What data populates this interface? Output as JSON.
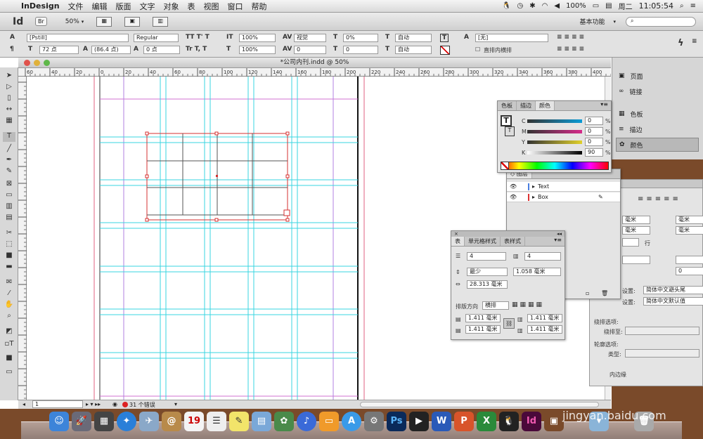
{
  "menubar": {
    "app_name": "InDesign",
    "items": [
      "文件",
      "编辑",
      "版面",
      "文字",
      "对象",
      "表",
      "视图",
      "窗口",
      "帮助"
    ],
    "battery": "100%",
    "day": "周二",
    "time": "11:05:54"
  },
  "appbar": {
    "logo": "Id",
    "bridge": "Br",
    "zoom": "50%",
    "workspace": "基本功能",
    "search_placeholder": ""
  },
  "control": {
    "font_family": "[Pstill]",
    "font_style": "Regular",
    "font_size": "72 点",
    "leading": "(86.4 点)",
    "scale_v": "100%",
    "scale_h": "100%",
    "kerning": "视觉",
    "tracking": "0",
    "baseline": "0 点",
    "tsume": "0%",
    "auto1": "自动",
    "auto2": "自动",
    "char_style": "[无]",
    "direct_horizontal": "直排内横排",
    "skew": "0",
    "tracking2": "0"
  },
  "document": {
    "title": "*公司内刊.indd @ 50%",
    "ruler_labels_h": [
      "60",
      "40",
      "20",
      "0",
      "20",
      "40",
      "60",
      "80",
      "100",
      "120",
      "140",
      "160",
      "180",
      "200",
      "220",
      "240",
      "260",
      "280",
      "300",
      "320",
      "340",
      "360",
      "380",
      "400"
    ],
    "page_number": "1",
    "errors": "31 个错误"
  },
  "sidebar": {
    "items": [
      {
        "label": "页面",
        "icon": "pages-icon"
      },
      {
        "label": "链接",
        "icon": "links-icon"
      },
      {
        "label": "色板",
        "icon": "swatches-icon"
      },
      {
        "label": "描边",
        "icon": "stroke-icon"
      },
      {
        "label": "颜色",
        "icon": "color-icon"
      }
    ]
  },
  "color_panel": {
    "tabs": [
      "色板",
      "描边",
      "颜色"
    ],
    "c_label": "C",
    "m_label": "M",
    "y_label": "Y",
    "k_label": "K",
    "c": "0",
    "m": "0",
    "y": "0",
    "k": "90",
    "pct": "%"
  },
  "layers_panel": {
    "title": "图层",
    "layers": [
      "Text",
      "Box"
    ]
  },
  "table_panel": {
    "tabs": [
      "表",
      "单元格样式",
      "表样式"
    ],
    "rows": "4",
    "cols": "4",
    "row_height_mode": "最少",
    "row_height": "1.058 毫米",
    "col_width": "28.313 毫米",
    "direction_label": "排版方向",
    "direction": "横排",
    "inset_top": "1.411 毫米",
    "inset_bottom": "1.411 毫米",
    "inset_left": "1.411 毫米",
    "inset_right": "1.411 毫米"
  },
  "right_panel": {
    "unit1": "毫米",
    "unit2": "毫米",
    "unit3": "毫米",
    "unit4": "毫米",
    "row_label": "行",
    "val0": "0",
    "setting1_label": "设置:",
    "setting1_value": "简体中文避头尾",
    "setting2_label": "设置:",
    "setting2_value": "简体中文默认值",
    "wrap_label": "绕排选项:",
    "wrap_shape": "绕排至:",
    "outline_label": "轮廓选项:",
    "outline_type": "类型:",
    "inner_edge": "内边缘"
  },
  "watermark": "jingyan.baidu.com"
}
